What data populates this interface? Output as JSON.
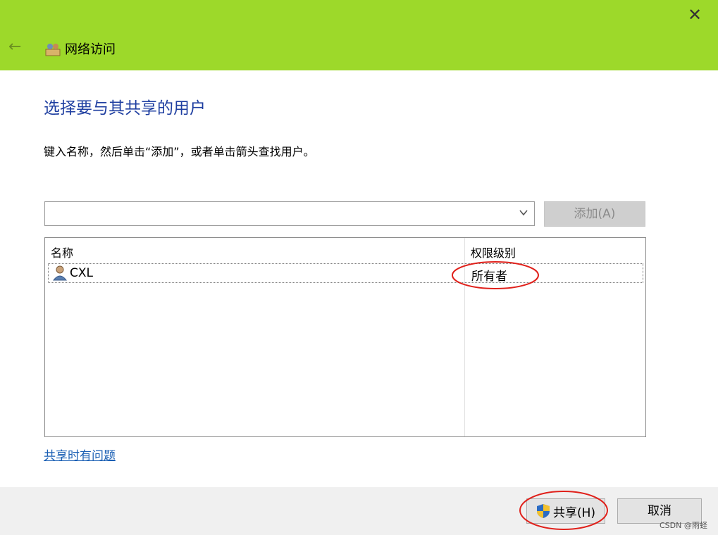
{
  "window": {
    "title": "网络访问",
    "close_glyph": "✕",
    "back_glyph": "←",
    "accent": "#9dd92a"
  },
  "main": {
    "heading": "选择要与其共享的用户",
    "instruction": "键入名称，然后单击“添加”，或者单击箭头查找用户。",
    "combo_value": "",
    "add_button": "添加(A)"
  },
  "table": {
    "columns": [
      "名称",
      "权限级别"
    ],
    "rows": [
      {
        "name": "CXL",
        "permission": "所有者",
        "icon": "user-icon"
      }
    ]
  },
  "help_link": "共享时有问题",
  "footer": {
    "share_button": "共享(H)",
    "cancel_button": "取消",
    "share_icon": "uac-shield-icon"
  },
  "watermark": "CSDN @雨蛏",
  "colors": {
    "heading": "#1e3ea0",
    "link": "#1a5fb4",
    "annotation": "#e0201a"
  }
}
